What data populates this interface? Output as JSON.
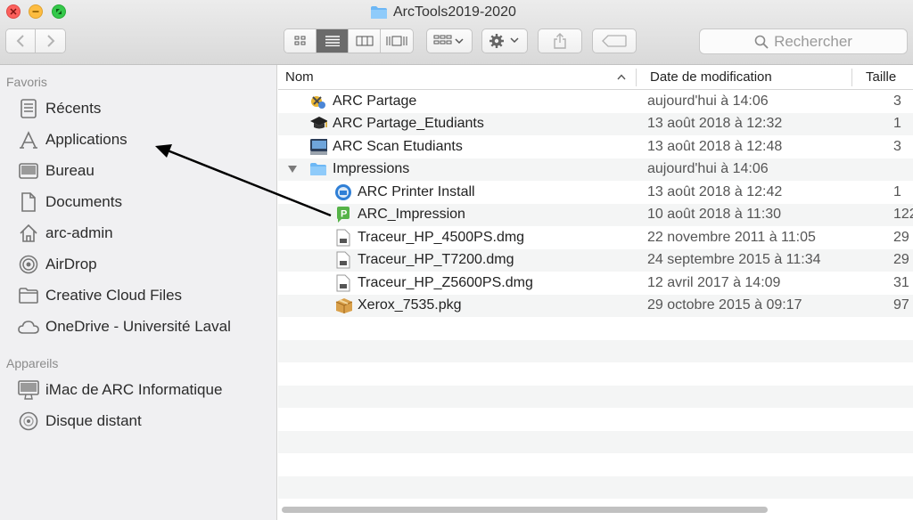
{
  "window": {
    "title": "ArcTools2019-2020"
  },
  "toolbar": {
    "search_placeholder": "Rechercher",
    "icons": [
      "chevron-left-icon",
      "chevron-right-icon",
      "icon-view-icon",
      "list-view-icon",
      "column-view-icon",
      "gallery-view-icon",
      "arrange-icon",
      "gear-icon",
      "share-icon",
      "tag-icon"
    ]
  },
  "sidebar": {
    "favorites_title": "Favoris",
    "favorites": [
      {
        "label": "Récents",
        "icon": "recents-icon"
      },
      {
        "label": "Applications",
        "icon": "applications-icon"
      },
      {
        "label": "Bureau",
        "icon": "desktop-icon"
      },
      {
        "label": "Documents",
        "icon": "documents-icon"
      },
      {
        "label": "arc-admin",
        "icon": "home-icon"
      },
      {
        "label": "AirDrop",
        "icon": "airdrop-icon"
      },
      {
        "label": "Creative Cloud Files",
        "icon": "folder-icon"
      },
      {
        "label": "OneDrive - Université Laval",
        "icon": "cloud-icon"
      }
    ],
    "devices_title": "Appareils",
    "devices": [
      {
        "label": "iMac de ARC Informatique",
        "icon": "imac-icon"
      },
      {
        "label": "Disque distant",
        "icon": "remote-disc-icon"
      }
    ]
  },
  "file_list": {
    "columns": {
      "name": "Nom",
      "date": "Date de modification",
      "size": "Taille"
    },
    "rows": [
      {
        "name": "ARC Partage",
        "date": "aujourd'hui à 14:06",
        "size": "3",
        "icon": "app-icon-partage",
        "indent": 0
      },
      {
        "name": "ARC Partage_Etudiants",
        "date": "13 août 2018 à 12:32",
        "size": "1",
        "icon": "graduation-cap-icon",
        "indent": 0
      },
      {
        "name": "ARC Scan Etudiants",
        "date": "13 août 2018 à 12:48",
        "size": "3",
        "icon": "scanner-icon",
        "indent": 0
      },
      {
        "name": "Impressions",
        "date": "aujourd'hui à 14:06",
        "size": "",
        "icon": "folder-icon",
        "indent": 0,
        "expanded": true
      },
      {
        "name": "ARC Printer Install",
        "date": "13 août 2018 à 12:42",
        "size": "1",
        "icon": "printer-install-icon",
        "indent": 1
      },
      {
        "name": "ARC_Impression",
        "date": "10 août 2018 à 11:30",
        "size": "122",
        "icon": "green-p-icon",
        "indent": 1
      },
      {
        "name": "Traceur_HP_4500PS.dmg",
        "date": "22 novembre 2011 à 11:05",
        "size": "29",
        "icon": "dmg-file-icon",
        "indent": 1
      },
      {
        "name": "Traceur_HP_T7200.dmg",
        "date": "24 septembre 2015 à 11:34",
        "size": "29",
        "icon": "dmg-file-icon",
        "indent": 1
      },
      {
        "name": "Traceur_HP_Z5600PS.dmg",
        "date": "12 avril 2017 à 14:09",
        "size": "31",
        "icon": "dmg-file-icon",
        "indent": 1
      },
      {
        "name": "Xerox_7535.pkg",
        "date": "29 octobre 2015 à 09:17",
        "size": "97",
        "icon": "package-icon",
        "indent": 1
      }
    ]
  },
  "colors": {
    "accent": "#3d8ee8",
    "folder": "#5fb0f5",
    "arrow": "#000000"
  }
}
